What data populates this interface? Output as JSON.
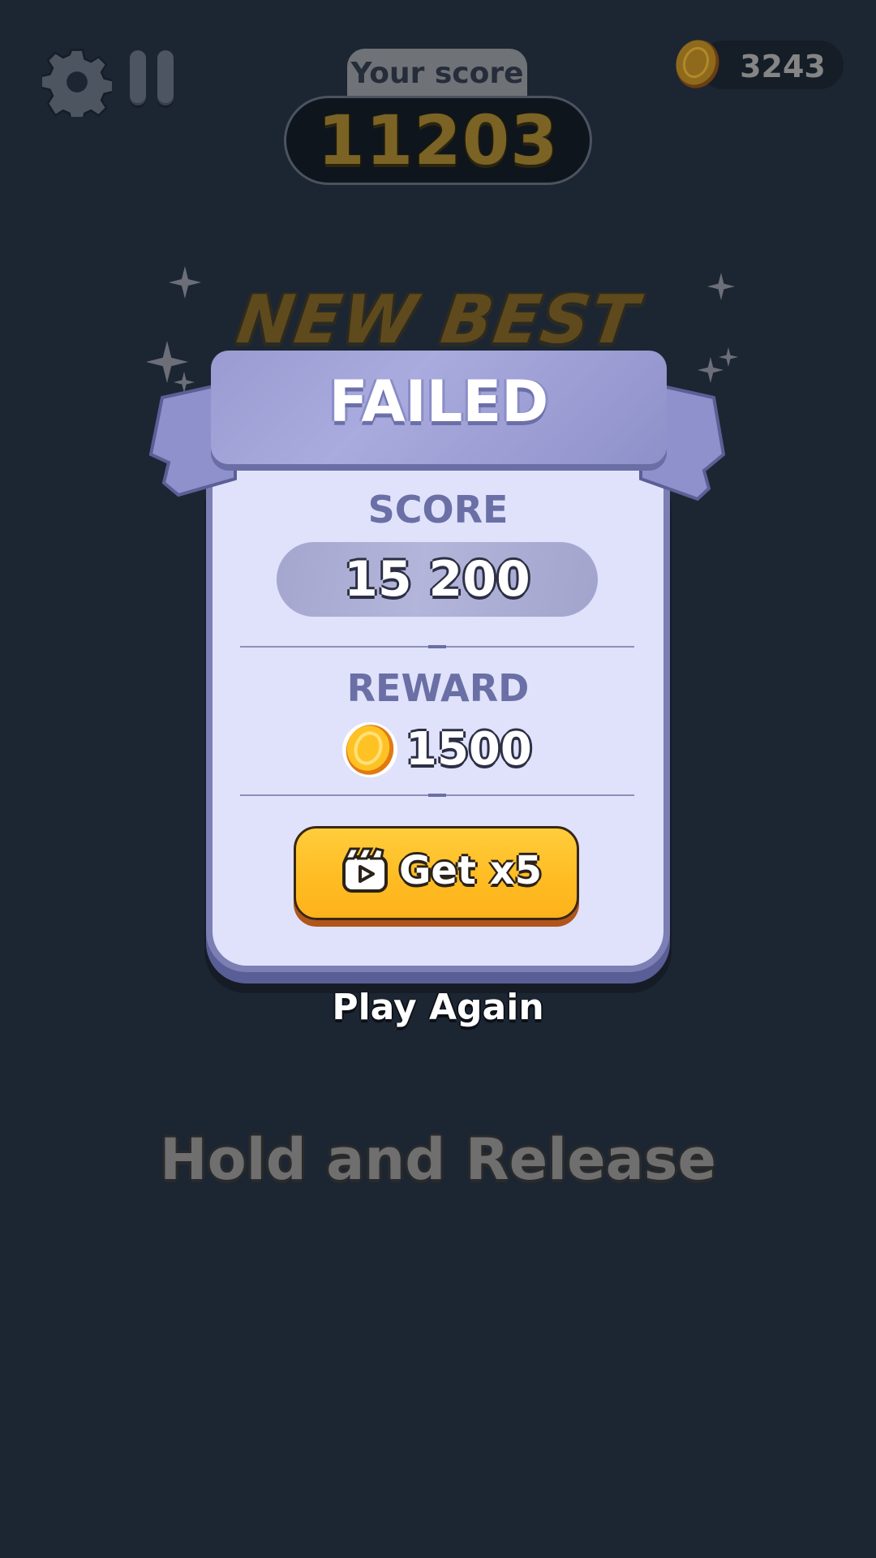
{
  "top_bar": {
    "settings_icon": "gear-icon",
    "pause_icon": "pause-icon",
    "score_label": "Your score",
    "score_value": "11203",
    "coin_icon": "coin-icon",
    "coins": "3243"
  },
  "result": {
    "headline": "NEW BEST SCORE",
    "status": "FAILED",
    "score_label": "SCORE",
    "score_value": "15 200",
    "reward_label": "REWARD",
    "reward_icon": "coin-icon",
    "reward_value": "1500",
    "multiplier_button": {
      "icon": "video-clapper-icon",
      "label": "Get x5"
    },
    "play_again": "Play Again"
  },
  "hint": "Hold and Release",
  "colors": {
    "background": "#1c2633",
    "card": "#dfe2fa",
    "accent": "#ffbb22",
    "banner": "#9a9bd1"
  }
}
